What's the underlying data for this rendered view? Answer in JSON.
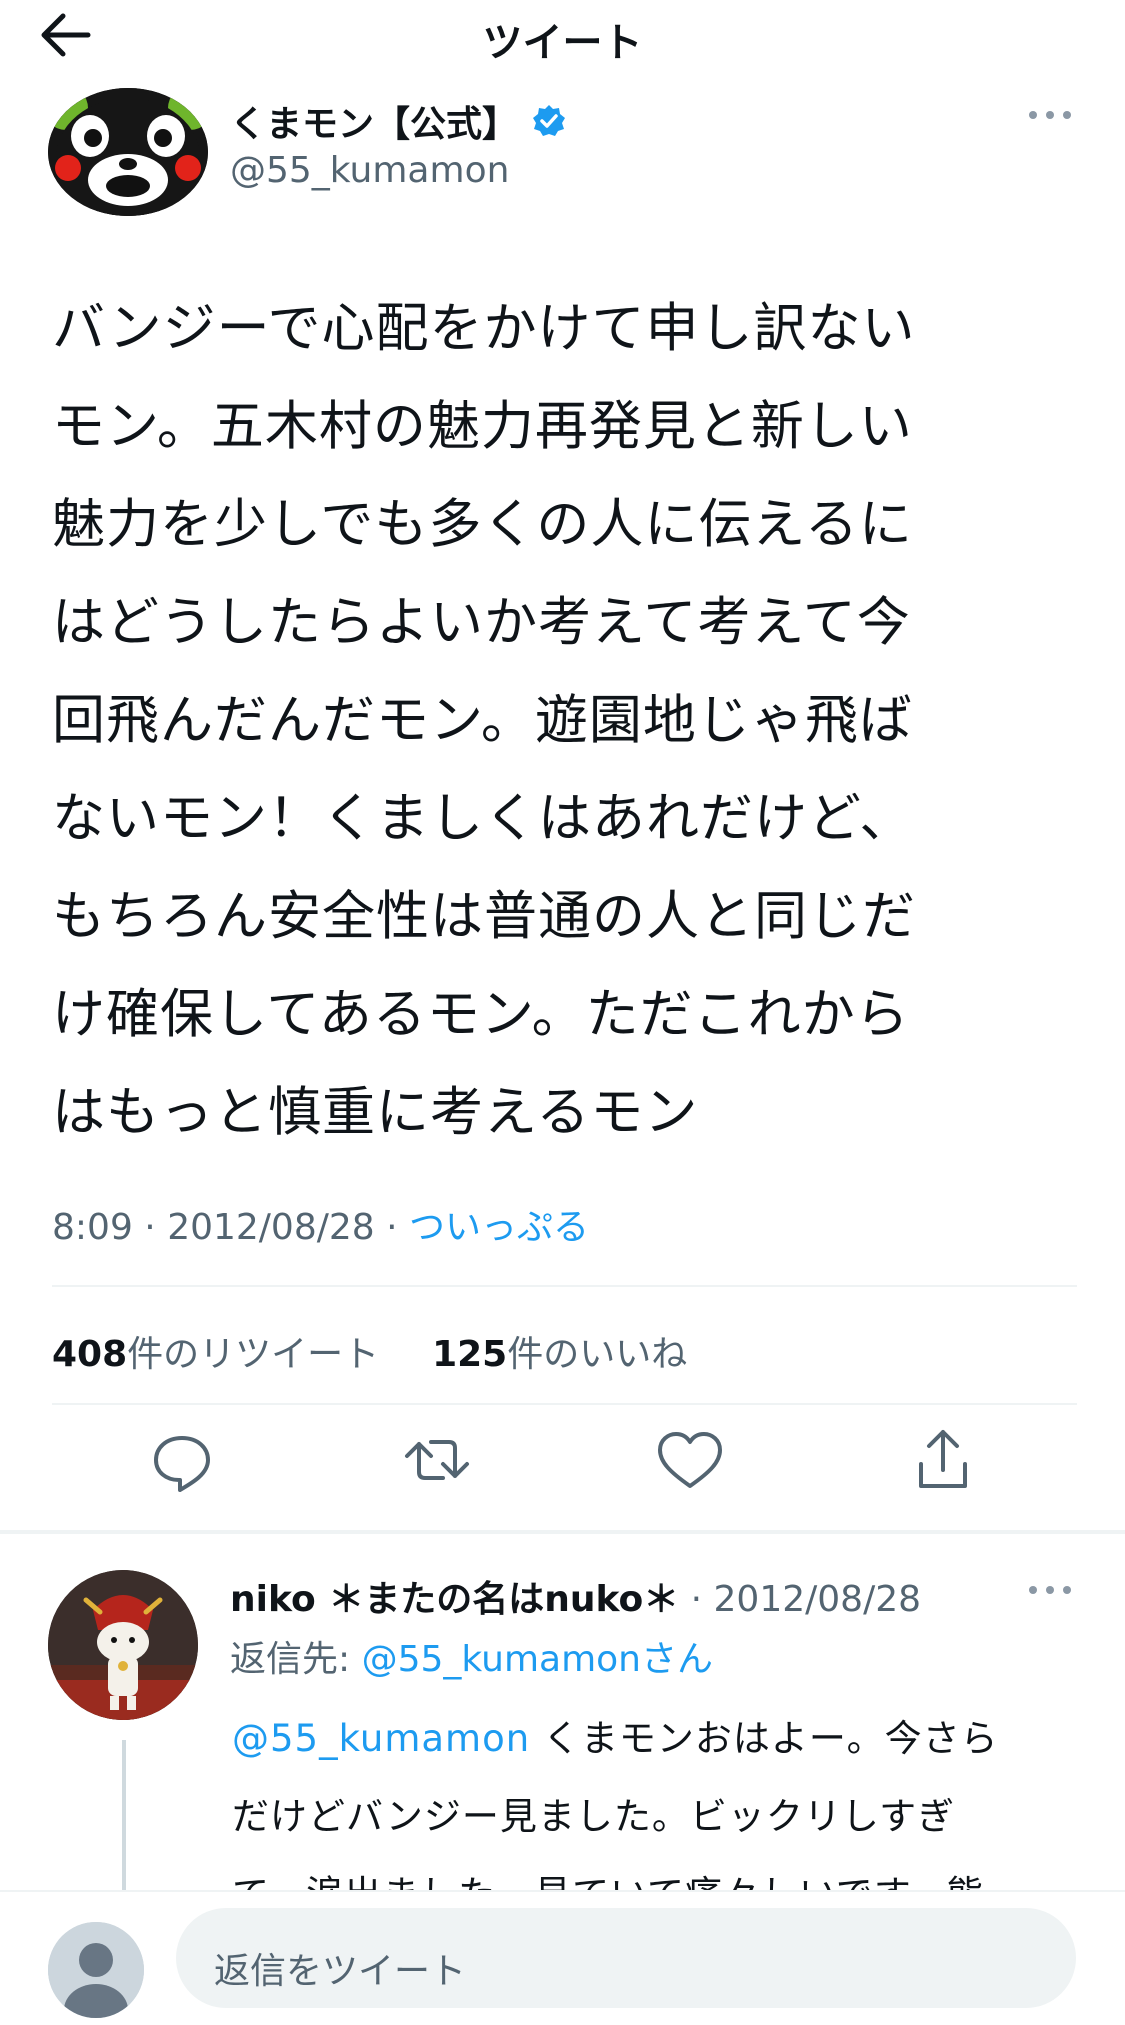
{
  "header": {
    "title": "ツイート",
    "back_icon": "arrow-left-icon"
  },
  "tweet": {
    "author_name": "くまモン【公式】",
    "handle": "@55_kumamon",
    "verified": true,
    "text": "バンジーで心配をかけて申し訳ない\nモン。五木村の魅力再発見と新しい\n魅力を少しでも多くの人に伝えるに\nはどうしたらよいか考えて考えて今\n回飛んだんだモン。遊園地じゃ飛ば\nないモン！くましくはあれだけど、\nもちろん安全性は普通の人と同じだ\nけ確保してあるモン。ただこれから\nはもっと慎重に考えるモン",
    "time": "8:09",
    "date": "2012/08/28",
    "source": "ついっぷる",
    "retweet_count": "408",
    "retweet_label": "件のリツイート",
    "like_count": "125",
    "like_label": "件のいいね"
  },
  "actions": [
    "reply-icon",
    "retweet-icon",
    "like-icon",
    "share-icon"
  ],
  "reply": {
    "author_name": "niko ＊またの名はnuko＊",
    "date": "2012/08/28",
    "replying_label": "返信先: ",
    "replying_to": "@55_kumamonさん",
    "mention": "@55_kumamon",
    "text": " くまモンおはよー。今さら\nだけどバンジー見ました。ビックリしすぎ\nて、涙出ました。見ていて痛々しいです。熊"
  },
  "composer": {
    "placeholder": "返信をツイート"
  },
  "colors": {
    "accent": "#1d9bf0",
    "secondary_text": "#536471",
    "divider": "#eff3f4"
  }
}
